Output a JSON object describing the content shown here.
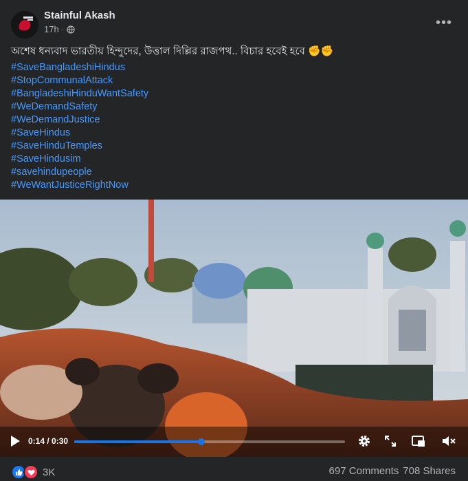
{
  "post": {
    "author": "Stainful Akash",
    "time": "17h",
    "dot": "·",
    "visibility_icon": "globe-icon",
    "more_label": "•••",
    "caption": "অশেষ ধন্যবাদ ভারতীয় হিন্দুদের, উত্তাল দিল্লির রাজপথ.. বিচার হবেই হবে",
    "caption_emoji": "✊✊",
    "hashtags": [
      "#SaveBangladeshiHindus",
      "#StopCommunalAttack",
      "#BangladeshiHinduWantSafety",
      "#WeDemandSafety",
      "#WeDemandJustice",
      "#SaveHindus",
      "#SaveHinduTemples",
      "#SaveHindusim",
      "#savehindupeople",
      "#WeWantJusticeRightNow"
    ]
  },
  "video": {
    "current_time": "0:14 / 0:30",
    "progress": 0.47,
    "accent": "#1b74e4"
  },
  "footer": {
    "reaction_count": "3K",
    "comments": "697 Comments",
    "shares": "708 Shares"
  },
  "colors": {
    "background": "#242526",
    "link": "#4599ff",
    "secondary_text": "#b0b3b8"
  }
}
